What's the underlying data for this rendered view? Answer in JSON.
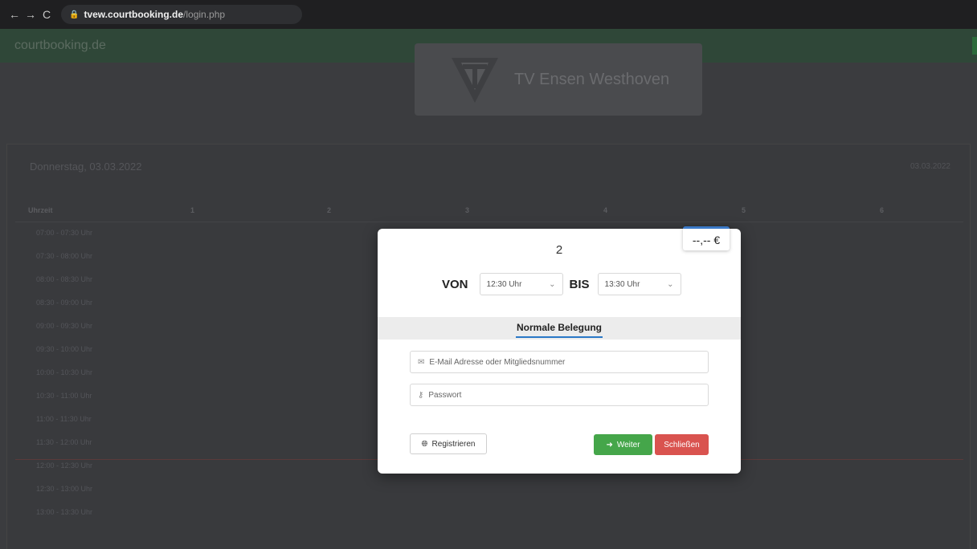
{
  "browser": {
    "back": "←",
    "forward": "→",
    "reload": "C",
    "url_host": "tvew.courtbooking.de",
    "url_path": "/login.php"
  },
  "background": {
    "brand": "courtbooking.de",
    "club_name": "TV Ensen Westhoven",
    "day_label": "Donnerstag, 03.03.2022",
    "date_short": "03.03.2022",
    "columns": [
      "Uhrzeit",
      "1",
      "2",
      "3",
      "4",
      "5",
      "6"
    ],
    "time_slots": [
      "07:00 - 07:30 Uhr",
      "07:30 - 08:00 Uhr",
      "08:00 - 08:30 Uhr",
      "08:30 - 09:00 Uhr",
      "09:00 - 09:30 Uhr",
      "09:30 - 10:00 Uhr",
      "10:00 - 10:30 Uhr",
      "10:30 - 11:00 Uhr",
      "11:00 - 11:30 Uhr",
      "11:30 - 12:00 Uhr",
      "12:00 - 12:30 Uhr",
      "12:30 - 13:00 Uhr",
      "13:00 - 13:30 Uhr"
    ]
  },
  "modal": {
    "court": "2",
    "price": "--,-- €",
    "von_label": "VON",
    "von_value": "12:30 Uhr",
    "bis_label": "BIS",
    "bis_value": "13:30 Uhr",
    "tab_label": "Normale Belegung",
    "email_placeholder": "E-Mail Adresse oder Mitgliedsnummer",
    "password_placeholder": "Passwort",
    "register_label": "Registrieren",
    "continue_label": "Weiter",
    "close_label": "Schließen"
  },
  "colors": {
    "accent_blue": "#2a78c7",
    "continue_green": "#45a64a",
    "close_red": "#d9534f"
  }
}
